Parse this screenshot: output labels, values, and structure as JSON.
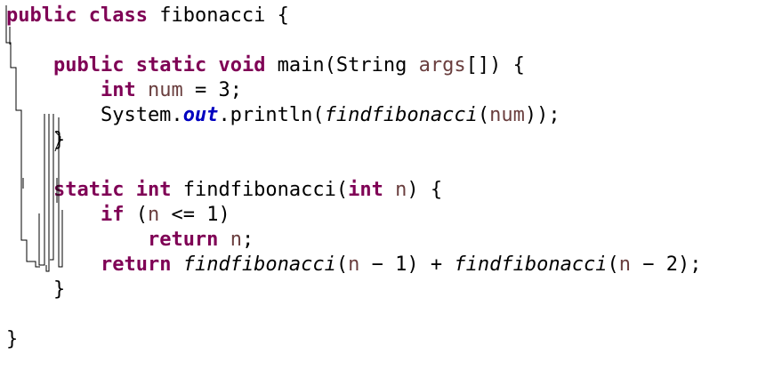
{
  "code": {
    "l1": {
      "t1": "public",
      "t2": " ",
      "t3": "class",
      "t4": " fibonacci {"
    },
    "l3": {
      "t0": "    ",
      "t1": "public",
      "t2": " ",
      "t3": "static",
      "t4": " ",
      "t5": "void",
      "t6": " main(String ",
      "t7": "args",
      "t8": "[]) {"
    },
    "l4": {
      "t0": "        ",
      "t1": "int",
      "t2": " ",
      "t3": "num",
      "t4": " = 3;"
    },
    "l5": {
      "t0": "        System.",
      "t1": "out",
      "t2": ".println(",
      "t3": "findfibonacci",
      "t4": "(",
      "t5": "num",
      "t6": "));"
    },
    "l6": {
      "t0": "    }"
    },
    "l8": {
      "t0": "    ",
      "t1": "static",
      "t2": " ",
      "t3": "int",
      "t4": " findfibonacci(",
      "t5": "int",
      "t6": " ",
      "t7": "n",
      "t8": ") {"
    },
    "l9": {
      "t0": "        ",
      "t1": "if",
      "t2": " (",
      "t3": "n",
      "t4": " <= 1)"
    },
    "l10": {
      "t0": "            ",
      "t1": "return",
      "t2": " ",
      "t3": "n",
      "t4": ";"
    },
    "l11": {
      "t0": "        ",
      "t1": "return",
      "t2": " ",
      "t3": "findfibonacci",
      "t4": "(",
      "t5": "n",
      "t6": " − 1) + ",
      "t7": "findfibonacci",
      "t8": "(",
      "t9": "n",
      "t10": " − 2);"
    },
    "l12": {
      "t0": "    }"
    },
    "l14": {
      "t0": "}"
    }
  },
  "colors": {
    "keyword": "#7f0055",
    "local_variable": "#6a3e3e",
    "static_field": "#0000c0",
    "default_text": "#000000",
    "background": "#ffffff"
  }
}
